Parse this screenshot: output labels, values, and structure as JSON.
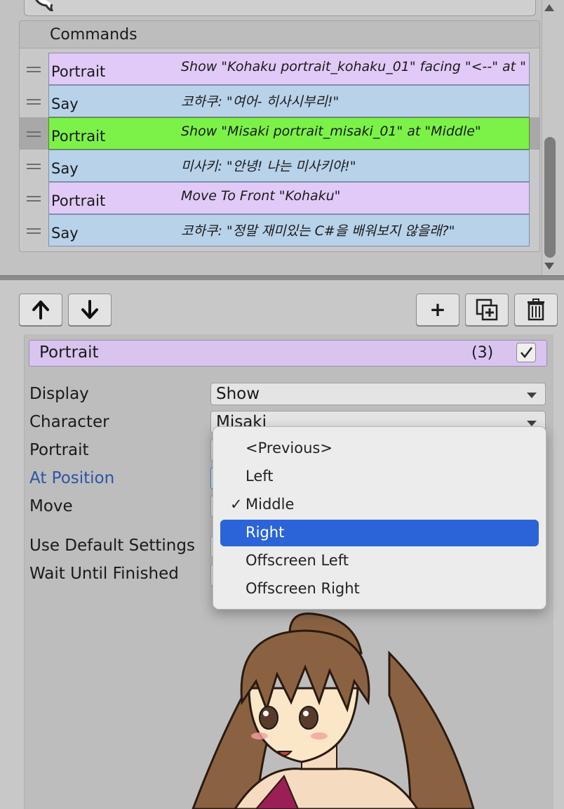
{
  "command_list": {
    "header": "Commands",
    "rows": [
      {
        "name": "Portrait",
        "summary": "Show \"Kohaku portrait_kohaku_01\" facing \"<--\" at \"",
        "bg": "#e1caf7",
        "selected": false
      },
      {
        "name": "Say",
        "summary": "코하쿠: \"여어- 히사시부리!\"",
        "bg": "#b8d2ea",
        "selected": false
      },
      {
        "name": "Portrait",
        "summary": "Show \"Misaki portrait_misaki_01\" at \"Middle\"",
        "bg": "#7cf248",
        "selected": true
      },
      {
        "name": "Say",
        "summary": "미사키: \"안녕! 나는 미사키야!\"",
        "bg": "#b8d2ea",
        "selected": false
      },
      {
        "name": "Portrait",
        "summary": "Move To Front \"Kohaku\"",
        "bg": "#e1caf7",
        "selected": false
      },
      {
        "name": "Say",
        "summary": "코하쿠: \"정말 재미있는 C#을 배워보지 않을래?\"",
        "bg": "#b8d2ea",
        "selected": false
      }
    ]
  },
  "toolbar": {
    "up_icon": "arrow-up-icon",
    "down_icon": "arrow-down-icon",
    "add_label": "+",
    "duplicate_icon": "duplicate-icon",
    "delete_icon": "trash-icon"
  },
  "inspector": {
    "command_name": "Portrait",
    "command_index": "(3)",
    "enabled": true,
    "header_bg": "#d9c4f0",
    "properties": {
      "display": {
        "label": "Display",
        "value": "Show"
      },
      "character": {
        "label": "Character",
        "value": "Misaki"
      },
      "portrait": {
        "label": "Portrait"
      },
      "at_position": {
        "label": "At Position",
        "label_color": "#2a55a8"
      },
      "move": {
        "label": "Move"
      },
      "use_default_settings": {
        "label": "Use Default Settings"
      },
      "wait_until_finished": {
        "label": "Wait Until Finished"
      }
    }
  },
  "dropdown": {
    "options": [
      {
        "label": "<Previous>",
        "checked": false,
        "highlighted": false
      },
      {
        "label": "Left",
        "checked": false,
        "highlighted": false
      },
      {
        "label": "Middle",
        "checked": true,
        "highlighted": false
      },
      {
        "label": "Right",
        "checked": false,
        "highlighted": true
      },
      {
        "label": "Offscreen Left",
        "checked": false,
        "highlighted": false
      },
      {
        "label": "Offscreen Right",
        "checked": false,
        "highlighted": false
      }
    ],
    "check_mark": "✓",
    "highlight_color": "#2b64d8"
  }
}
